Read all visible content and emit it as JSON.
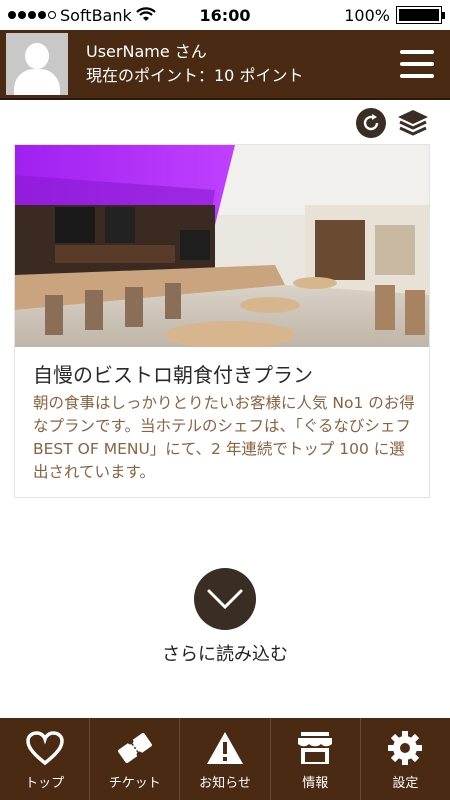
{
  "status_bar": {
    "carrier": "SoftBank",
    "time": "16:00",
    "battery": "100%",
    "battery_level": 1.0,
    "signal_bars_filled": 4,
    "signal_bars_total": 5
  },
  "header": {
    "username": "UserName さん",
    "points": "現在のポイント：10 ポイント"
  },
  "card": {
    "title": "自慢のビストロ朝食付きプラン",
    "description": "朝の食事はしっかりとりたいお客様に人気 No1 のお得なプランです。当ホテルのシェフは、「ぐるなびシェフ BEST OF MENU」にて、2 年連続でトップ 100 に選出されています。"
  },
  "load_more": {
    "label": "さらに読み込む"
  },
  "nav": {
    "items": [
      {
        "label": "トップ",
        "icon": "heart-icon"
      },
      {
        "label": "チケット",
        "icon": "ticket-icon"
      },
      {
        "label": "お知らせ",
        "icon": "warning-icon"
      },
      {
        "label": "情報",
        "icon": "shop-icon"
      },
      {
        "label": "設定",
        "icon": "gear-icon"
      }
    ]
  },
  "colors": {
    "brand_brown": "#4a2a12",
    "description_text": "#8b6240",
    "load_circle": "#3a2d24"
  }
}
